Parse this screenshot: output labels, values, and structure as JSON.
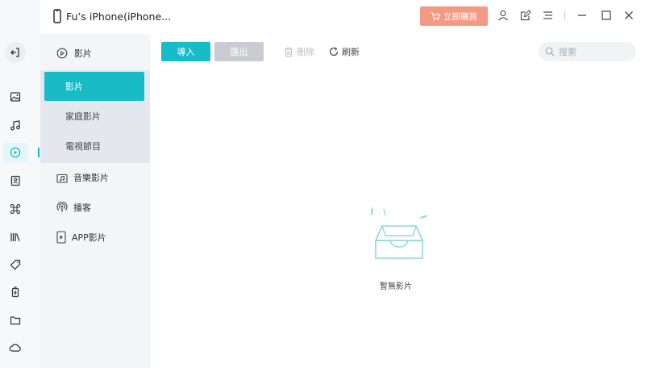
{
  "window": {
    "device_name": "Fu’s iPhone(iPhone...",
    "buy_label": "立即購買"
  },
  "rail": {
    "items": [
      "back-icon",
      "photos-icon",
      "music-icon",
      "video-icon",
      "contacts-icon",
      "apps-icon",
      "books-icon",
      "tags-icon",
      "battery-icon",
      "files-icon",
      "cloud-icon"
    ],
    "active": "video-icon"
  },
  "categories": {
    "header": "影片",
    "sub_items": [
      {
        "label": "影片",
        "active": true
      },
      {
        "label": "家庭影片",
        "active": false
      },
      {
        "label": "電視節目",
        "active": false
      }
    ],
    "others": [
      {
        "label": "音樂影片",
        "icon": "music-video-icon"
      },
      {
        "label": "播客",
        "icon": "podcast-icon"
      },
      {
        "label": "APP影片",
        "icon": "app-video-icon"
      }
    ]
  },
  "toolbar": {
    "import_label": "導入",
    "export_label": "匯出",
    "delete_label": "刪除",
    "refresh_label": "刷新",
    "search_placeholder": "搜索"
  },
  "empty_state": {
    "message": "暫無影片"
  },
  "colors": {
    "accent": "#17bcc7",
    "buy_button": "#f49a84",
    "disabled": "#c9ccd0"
  }
}
